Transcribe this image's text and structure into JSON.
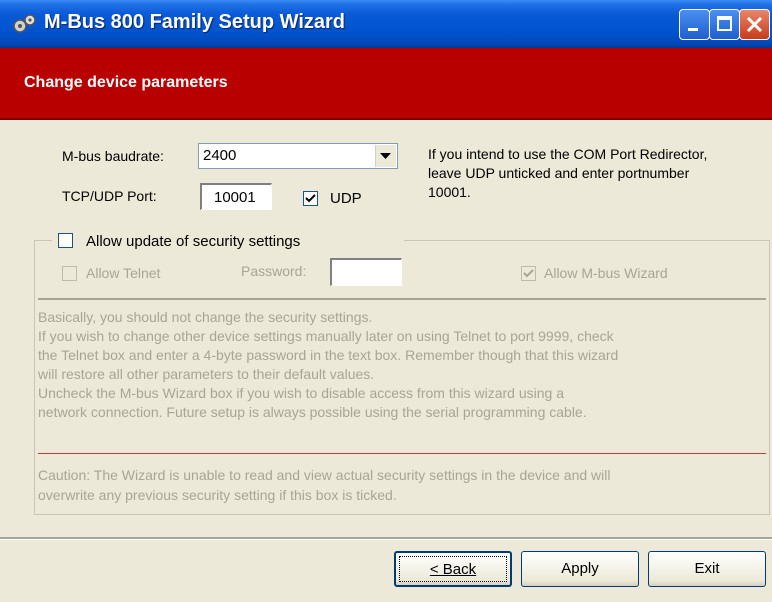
{
  "window": {
    "title": "M-Bus 800 Family Setup Wizard"
  },
  "header": {
    "title": "Change device parameters"
  },
  "form": {
    "baudrate_label": "M-bus baudrate:",
    "baudrate_value": "2400",
    "port_label": "TCP/UDP Port:",
    "port_value": "10001",
    "udp_label": "UDP",
    "udp_checked": true,
    "hint": [
      "If you intend to use the COM Port Redirector,",
      "leave UDP unticked and enter portnumber",
      "10001."
    ]
  },
  "security": {
    "allow_update_label": "Allow update of security settings",
    "allow_update_checked": false,
    "allow_telnet_label": "Allow Telnet",
    "allow_telnet_checked": false,
    "password_label": "Password:",
    "password_value": "",
    "allow_wizard_label": "Allow M-bus Wizard",
    "allow_wizard_checked": true,
    "info": [
      "Basically, you should not change the security settings.",
      "If you wish to change other device settings manually later on using Telnet to port 9999, check",
      "the Telnet box and enter a 4-byte password in the text box. Remember though that this wizard",
      "will restore all other parameters to their default values.",
      "Uncheck the M-bus Wizard box if you wish to disable access from this wizard using a",
      "network connection. Future setup is always possible using the serial programming cable."
    ],
    "caution": [
      "Caution: The Wizard is unable to read and view actual security settings in the device and will",
      "overwrite any previous security setting if this box is ticked."
    ]
  },
  "buttons": {
    "back": "< Back",
    "apply": "Apply",
    "exit": "Exit"
  },
  "colors": {
    "header_red": "#b90000",
    "titlebar_blue": "#0052cc",
    "face": "#ece9d8"
  }
}
